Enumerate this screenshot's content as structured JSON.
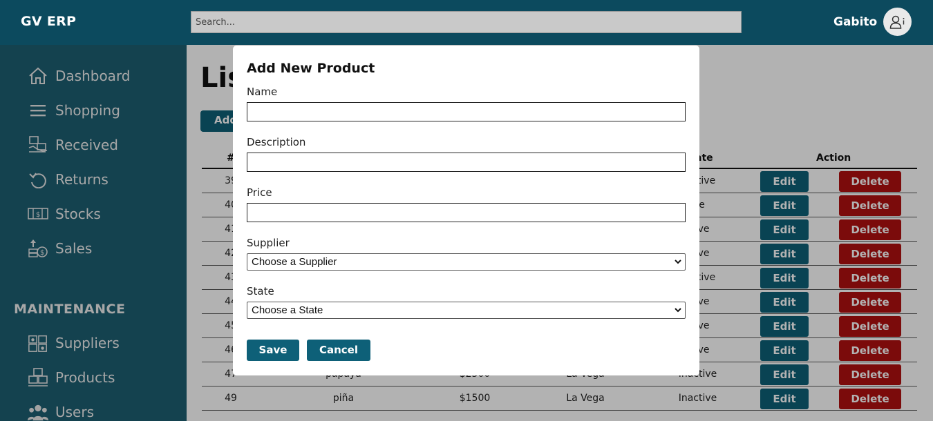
{
  "header": {
    "brand": "GV ERP",
    "search_placeholder": "Search...",
    "username": "Gabito",
    "avatar_icon": "user-info-icon"
  },
  "sidebar": {
    "items": [
      {
        "label": "Dashboard",
        "icon": "home-icon"
      },
      {
        "label": "Shopping",
        "icon": "menu-icon"
      },
      {
        "label": "Received",
        "icon": "received-icon"
      },
      {
        "label": "Returns",
        "icon": "undo-icon"
      },
      {
        "label": "Stocks",
        "icon": "stocks-icon"
      },
      {
        "label": "Sales",
        "icon": "sales-icon"
      }
    ],
    "maintenance_title": "MAINTENANCE",
    "maintenance_items": [
      {
        "label": "Suppliers",
        "icon": "suppliers-icon"
      },
      {
        "label": "Products",
        "icon": "boxes-icon"
      },
      {
        "label": "Users",
        "icon": "users-icon"
      }
    ]
  },
  "main": {
    "title_partial": "Lis",
    "add_button_partial": "Add",
    "columns": {
      "id": "#",
      "state": "ate",
      "action": "Action"
    },
    "rows": [
      {
        "id": "39",
        "name": "",
        "price": "",
        "location": "",
        "state": "nactive"
      },
      {
        "id": "40",
        "name": "",
        "price": "",
        "location": "",
        "state": "ive"
      },
      {
        "id": "41",
        "name": "",
        "price": "",
        "location": "",
        "state": "ctive"
      },
      {
        "id": "42",
        "name": "",
        "price": "",
        "location": "",
        "state": "ctive"
      },
      {
        "id": "43",
        "name": "",
        "price": "",
        "location": "",
        "state": "nactive"
      },
      {
        "id": "44",
        "name": "",
        "price": "",
        "location": "",
        "state": "ctive"
      },
      {
        "id": "45",
        "name": "",
        "price": "",
        "location": "",
        "state": "ctive"
      },
      {
        "id": "46",
        "name": "",
        "price": "",
        "location": "",
        "state": "ctive"
      },
      {
        "id": "47",
        "name": "papaya",
        "price": "$2500",
        "location": "La Vega",
        "state": "Inactive"
      },
      {
        "id": "49",
        "name": "piña",
        "price": "$1500",
        "location": "La Vega",
        "state": "Inactive"
      }
    ],
    "edit_label": "Edit",
    "delete_label": "Delete"
  },
  "modal": {
    "title": "Add New Product",
    "name_label": "Name",
    "description_label": "Description",
    "price_label": "Price",
    "supplier_label": "Supplier",
    "supplier_selected": "Choose a Supplier",
    "state_label": "State",
    "state_selected": "Choose a State",
    "save_label": "Save",
    "cancel_label": "Cancel"
  },
  "colors": {
    "header_bg": "#0c4a5e",
    "sidebar_bg": "#1d5f72",
    "primary_button": "#0e6078",
    "danger_button": "#b01010"
  }
}
